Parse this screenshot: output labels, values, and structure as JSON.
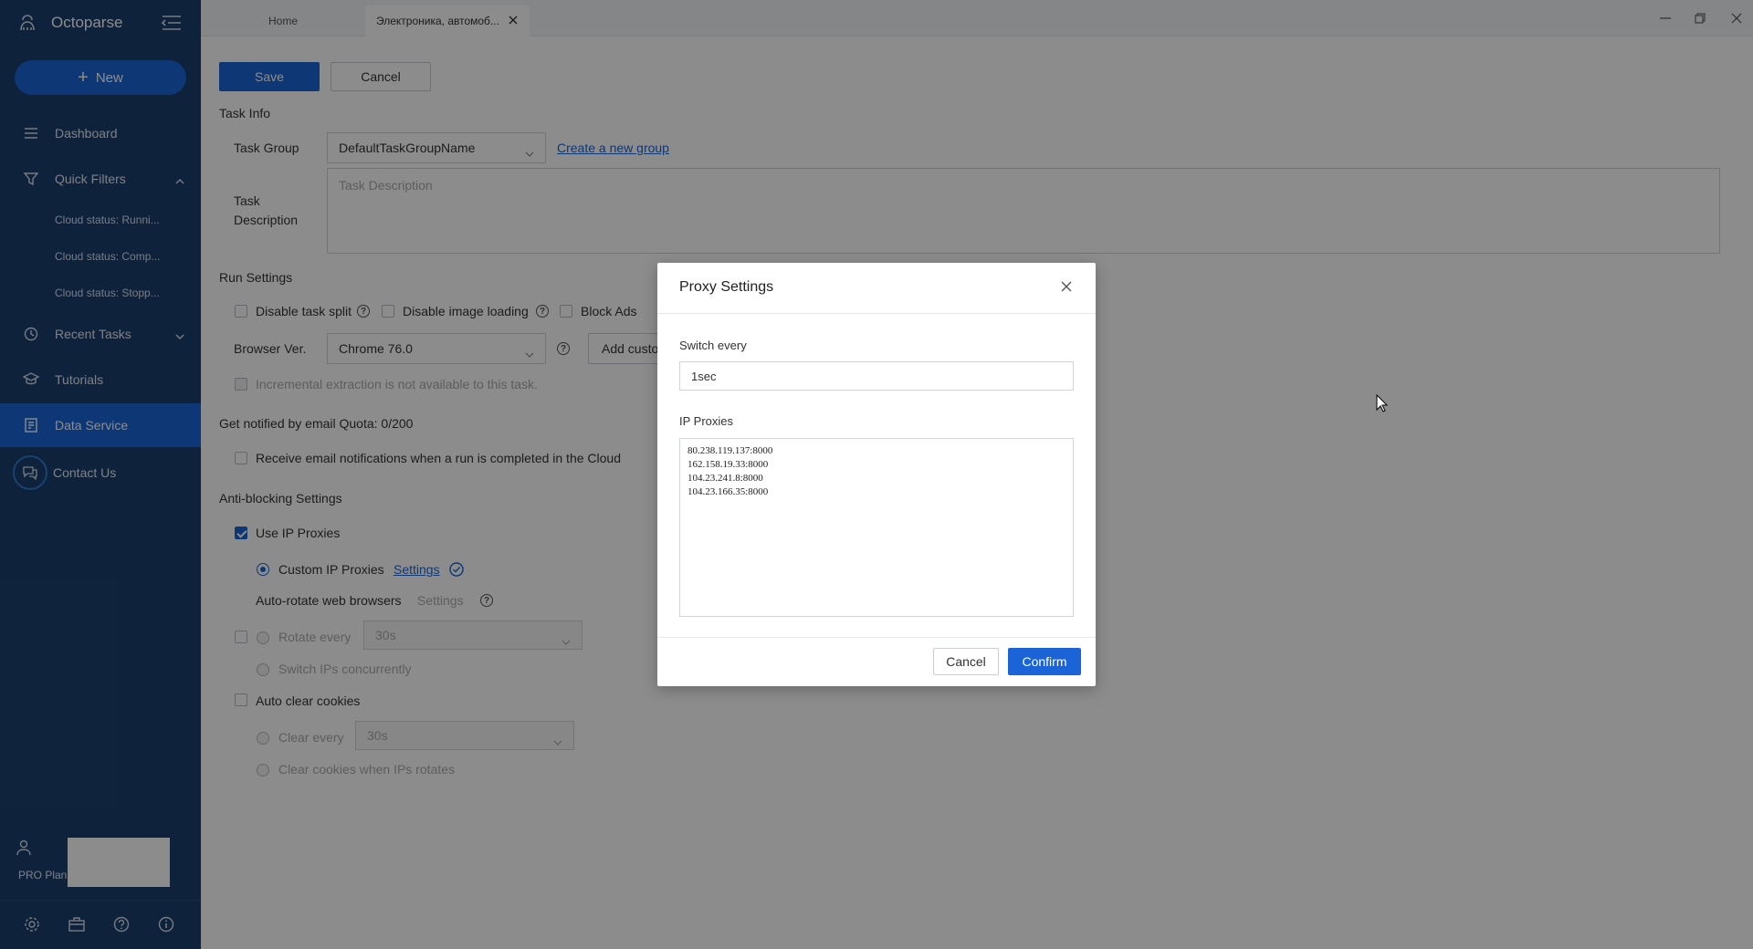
{
  "sidebar": {
    "brand": "Octoparse",
    "new_label": "New",
    "items": [
      {
        "label": "Dashboard"
      },
      {
        "label": "Quick Filters"
      },
      {
        "label": "Recent Tasks"
      },
      {
        "label": "Tutorials"
      },
      {
        "label": "Data Service"
      },
      {
        "label": "Contact Us"
      }
    ],
    "quick_filters": [
      "Cloud status: Runni...",
      "Cloud status: Comp...",
      "Cloud status: Stopp..."
    ],
    "plan": "PRO Plan",
    "accent": "#1a64d8",
    "background": "#1c3f6e"
  },
  "tabs": [
    {
      "label": "Home"
    },
    {
      "label": "Электроника, автомоб..."
    }
  ],
  "toolbar": {
    "save_label": "Save",
    "cancel_label": "Cancel"
  },
  "task_info": {
    "title": "Task Info",
    "group_label": "Task Group",
    "group_value": "DefaultTaskGroupName",
    "create_group_link": "Create a new group",
    "description_label": "Task Description",
    "description_placeholder": "Task Description"
  },
  "run_settings": {
    "title": "Run Settings",
    "disable_split": "Disable task split",
    "disable_images": "Disable image loading",
    "block_ads": "Block Ads",
    "browser_label": "Browser Ver.",
    "browser_value": "Chrome 76.0",
    "add_custom": "Add custo",
    "incremental": "Incremental extraction is not available to this task."
  },
  "notify": {
    "title": "Get notified by email Quota: 0/200",
    "receive": "Receive email notifications when a run is completed in the Cloud"
  },
  "anti_blocking": {
    "title": "Anti-blocking Settings",
    "use_proxies": "Use IP Proxies",
    "custom_proxies": "Custom IP Proxies",
    "settings_link": "Settings",
    "auto_rotate": "Auto-rotate web browsers",
    "settings_disabled": "Settings",
    "rotate_every": "Rotate every",
    "rotate_value": "30s",
    "switch_concurrently": "Switch IPs concurrently",
    "auto_clear": "Auto clear cookies",
    "clear_every": "Clear every",
    "clear_value": "30s",
    "clear_on_rotate": "Clear cookies when IPs rotates"
  },
  "dialog": {
    "title": "Proxy Settings",
    "switch_label": "Switch every",
    "switch_value": "1sec",
    "proxies_label": "IP Proxies",
    "proxies": [
      "80.238.119.137:8000",
      "162.158.19.33:8000",
      "104.23.241.8:8000",
      "104.23.166.35:8000"
    ],
    "cancel_label": "Cancel",
    "confirm_label": "Confirm"
  }
}
